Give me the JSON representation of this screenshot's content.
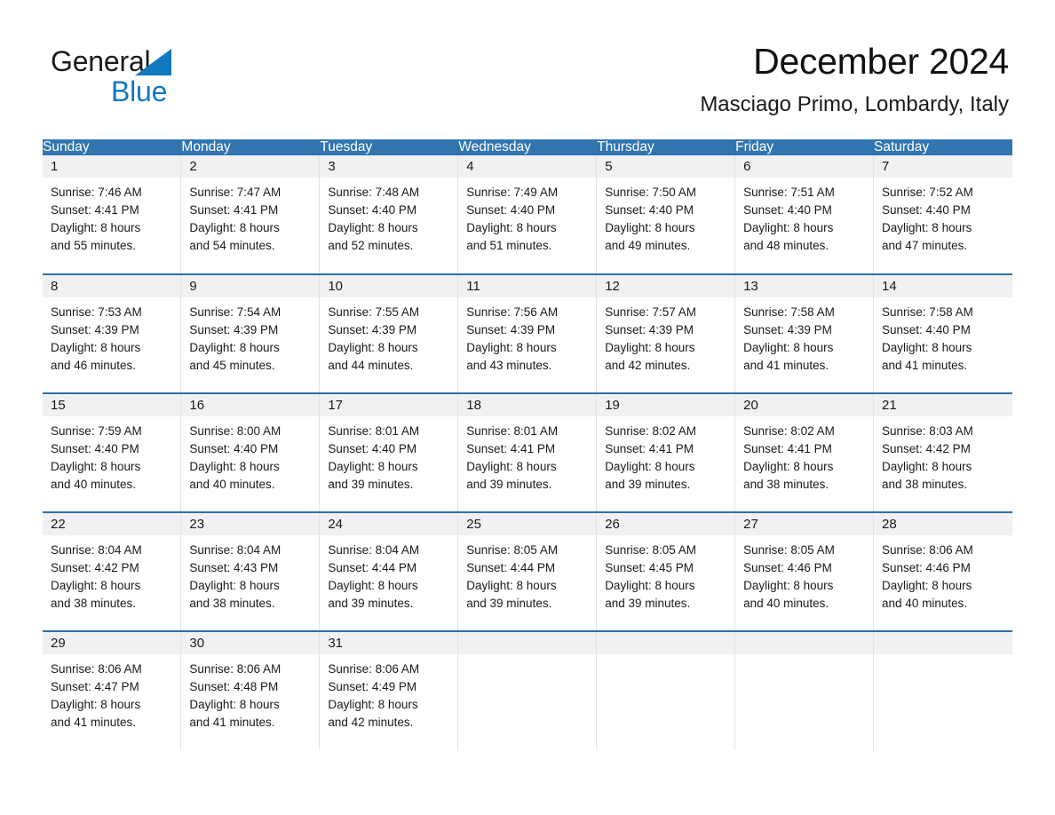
{
  "logo": {
    "text_general": "General",
    "text_blue": "Blue",
    "triangle_color": "#1179c0",
    "blue_color": "#1179c0"
  },
  "header": {
    "title": "December 2024",
    "subtitle": "Masciago Primo, Lombardy, Italy"
  },
  "theme": {
    "header_blue": "#3175b0",
    "row_divider_blue": "#2f6ea8",
    "daynum_band": "#f1f1f1",
    "text": "#1a1a1a"
  },
  "calendar": {
    "weekday_headers": [
      "Sunday",
      "Monday",
      "Tuesday",
      "Wednesday",
      "Thursday",
      "Friday",
      "Saturday"
    ],
    "weeks": [
      [
        {
          "day": "1",
          "sunrise": "Sunrise: 7:46 AM",
          "sunset": "Sunset: 4:41 PM",
          "daylight_line1": "Daylight: 8 hours",
          "daylight_line2": "and 55 minutes."
        },
        {
          "day": "2",
          "sunrise": "Sunrise: 7:47 AM",
          "sunset": "Sunset: 4:41 PM",
          "daylight_line1": "Daylight: 8 hours",
          "daylight_line2": "and 54 minutes."
        },
        {
          "day": "3",
          "sunrise": "Sunrise: 7:48 AM",
          "sunset": "Sunset: 4:40 PM",
          "daylight_line1": "Daylight: 8 hours",
          "daylight_line2": "and 52 minutes."
        },
        {
          "day": "4",
          "sunrise": "Sunrise: 7:49 AM",
          "sunset": "Sunset: 4:40 PM",
          "daylight_line1": "Daylight: 8 hours",
          "daylight_line2": "and 51 minutes."
        },
        {
          "day": "5",
          "sunrise": "Sunrise: 7:50 AM",
          "sunset": "Sunset: 4:40 PM",
          "daylight_line1": "Daylight: 8 hours",
          "daylight_line2": "and 49 minutes."
        },
        {
          "day": "6",
          "sunrise": "Sunrise: 7:51 AM",
          "sunset": "Sunset: 4:40 PM",
          "daylight_line1": "Daylight: 8 hours",
          "daylight_line2": "and 48 minutes."
        },
        {
          "day": "7",
          "sunrise": "Sunrise: 7:52 AM",
          "sunset": "Sunset: 4:40 PM",
          "daylight_line1": "Daylight: 8 hours",
          "daylight_line2": "and 47 minutes."
        }
      ],
      [
        {
          "day": "8",
          "sunrise": "Sunrise: 7:53 AM",
          "sunset": "Sunset: 4:39 PM",
          "daylight_line1": "Daylight: 8 hours",
          "daylight_line2": "and 46 minutes."
        },
        {
          "day": "9",
          "sunrise": "Sunrise: 7:54 AM",
          "sunset": "Sunset: 4:39 PM",
          "daylight_line1": "Daylight: 8 hours",
          "daylight_line2": "and 45 minutes."
        },
        {
          "day": "10",
          "sunrise": "Sunrise: 7:55 AM",
          "sunset": "Sunset: 4:39 PM",
          "daylight_line1": "Daylight: 8 hours",
          "daylight_line2": "and 44 minutes."
        },
        {
          "day": "11",
          "sunrise": "Sunrise: 7:56 AM",
          "sunset": "Sunset: 4:39 PM",
          "daylight_line1": "Daylight: 8 hours",
          "daylight_line2": "and 43 minutes."
        },
        {
          "day": "12",
          "sunrise": "Sunrise: 7:57 AM",
          "sunset": "Sunset: 4:39 PM",
          "daylight_line1": "Daylight: 8 hours",
          "daylight_line2": "and 42 minutes."
        },
        {
          "day": "13",
          "sunrise": "Sunrise: 7:58 AM",
          "sunset": "Sunset: 4:39 PM",
          "daylight_line1": "Daylight: 8 hours",
          "daylight_line2": "and 41 minutes."
        },
        {
          "day": "14",
          "sunrise": "Sunrise: 7:58 AM",
          "sunset": "Sunset: 4:40 PM",
          "daylight_line1": "Daylight: 8 hours",
          "daylight_line2": "and 41 minutes."
        }
      ],
      [
        {
          "day": "15",
          "sunrise": "Sunrise: 7:59 AM",
          "sunset": "Sunset: 4:40 PM",
          "daylight_line1": "Daylight: 8 hours",
          "daylight_line2": "and 40 minutes."
        },
        {
          "day": "16",
          "sunrise": "Sunrise: 8:00 AM",
          "sunset": "Sunset: 4:40 PM",
          "daylight_line1": "Daylight: 8 hours",
          "daylight_line2": "and 40 minutes."
        },
        {
          "day": "17",
          "sunrise": "Sunrise: 8:01 AM",
          "sunset": "Sunset: 4:40 PM",
          "daylight_line1": "Daylight: 8 hours",
          "daylight_line2": "and 39 minutes."
        },
        {
          "day": "18",
          "sunrise": "Sunrise: 8:01 AM",
          "sunset": "Sunset: 4:41 PM",
          "daylight_line1": "Daylight: 8 hours",
          "daylight_line2": "and 39 minutes."
        },
        {
          "day": "19",
          "sunrise": "Sunrise: 8:02 AM",
          "sunset": "Sunset: 4:41 PM",
          "daylight_line1": "Daylight: 8 hours",
          "daylight_line2": "and 39 minutes."
        },
        {
          "day": "20",
          "sunrise": "Sunrise: 8:02 AM",
          "sunset": "Sunset: 4:41 PM",
          "daylight_line1": "Daylight: 8 hours",
          "daylight_line2": "and 38 minutes."
        },
        {
          "day": "21",
          "sunrise": "Sunrise: 8:03 AM",
          "sunset": "Sunset: 4:42 PM",
          "daylight_line1": "Daylight: 8 hours",
          "daylight_line2": "and 38 minutes."
        }
      ],
      [
        {
          "day": "22",
          "sunrise": "Sunrise: 8:04 AM",
          "sunset": "Sunset: 4:42 PM",
          "daylight_line1": "Daylight: 8 hours",
          "daylight_line2": "and 38 minutes."
        },
        {
          "day": "23",
          "sunrise": "Sunrise: 8:04 AM",
          "sunset": "Sunset: 4:43 PM",
          "daylight_line1": "Daylight: 8 hours",
          "daylight_line2": "and 38 minutes."
        },
        {
          "day": "24",
          "sunrise": "Sunrise: 8:04 AM",
          "sunset": "Sunset: 4:44 PM",
          "daylight_line1": "Daylight: 8 hours",
          "daylight_line2": "and 39 minutes."
        },
        {
          "day": "25",
          "sunrise": "Sunrise: 8:05 AM",
          "sunset": "Sunset: 4:44 PM",
          "daylight_line1": "Daylight: 8 hours",
          "daylight_line2": "and 39 minutes."
        },
        {
          "day": "26",
          "sunrise": "Sunrise: 8:05 AM",
          "sunset": "Sunset: 4:45 PM",
          "daylight_line1": "Daylight: 8 hours",
          "daylight_line2": "and 39 minutes."
        },
        {
          "day": "27",
          "sunrise": "Sunrise: 8:05 AM",
          "sunset": "Sunset: 4:46 PM",
          "daylight_line1": "Daylight: 8 hours",
          "daylight_line2": "and 40 minutes."
        },
        {
          "day": "28",
          "sunrise": "Sunrise: 8:06 AM",
          "sunset": "Sunset: 4:46 PM",
          "daylight_line1": "Daylight: 8 hours",
          "daylight_line2": "and 40 minutes."
        }
      ],
      [
        {
          "day": "29",
          "sunrise": "Sunrise: 8:06 AM",
          "sunset": "Sunset: 4:47 PM",
          "daylight_line1": "Daylight: 8 hours",
          "daylight_line2": "and 41 minutes."
        },
        {
          "day": "30",
          "sunrise": "Sunrise: 8:06 AM",
          "sunset": "Sunset: 4:48 PM",
          "daylight_line1": "Daylight: 8 hours",
          "daylight_line2": "and 41 minutes."
        },
        {
          "day": "31",
          "sunrise": "Sunrise: 8:06 AM",
          "sunset": "Sunset: 4:49 PM",
          "daylight_line1": "Daylight: 8 hours",
          "daylight_line2": "and 42 minutes."
        },
        {
          "day": "",
          "sunrise": "",
          "sunset": "",
          "daylight_line1": "",
          "daylight_line2": ""
        },
        {
          "day": "",
          "sunrise": "",
          "sunset": "",
          "daylight_line1": "",
          "daylight_line2": ""
        },
        {
          "day": "",
          "sunrise": "",
          "sunset": "",
          "daylight_line1": "",
          "daylight_line2": ""
        },
        {
          "day": "",
          "sunrise": "",
          "sunset": "",
          "daylight_line1": "",
          "daylight_line2": ""
        }
      ]
    ]
  }
}
